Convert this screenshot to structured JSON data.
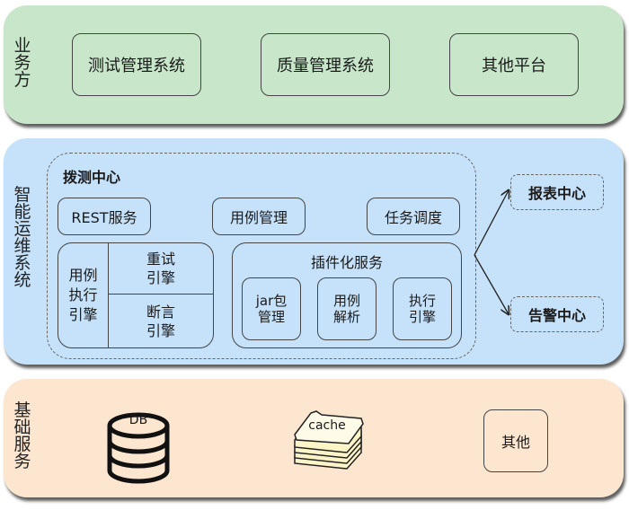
{
  "layers": {
    "business": {
      "label": "业务方",
      "color": "#c8e6c9",
      "items": [
        "测试管理系统",
        "质量管理系统",
        "其他平台"
      ]
    },
    "ops": {
      "label": "智能运维系统",
      "color": "#c6e2fb",
      "probe_center": {
        "title": "拨测中心",
        "top_services": [
          "REST服务",
          "用例管理",
          "任务调度"
        ],
        "execution_engine": {
          "label": "用例\n执行\n引擎",
          "sub": [
            "重试\n引擎",
            "断言\n引擎"
          ]
        },
        "plugin_service": {
          "title": "插件化服务",
          "items": [
            "jar包\n管理",
            "用例\n解析",
            "执行\n引擎"
          ]
        }
      },
      "outputs": [
        "报表中心",
        "告警中心"
      ]
    },
    "infra": {
      "label": "基础服务",
      "color": "#fde6d0",
      "items": {
        "db_label": "DB",
        "cache_label": "cache",
        "other_label": "其他"
      }
    }
  }
}
